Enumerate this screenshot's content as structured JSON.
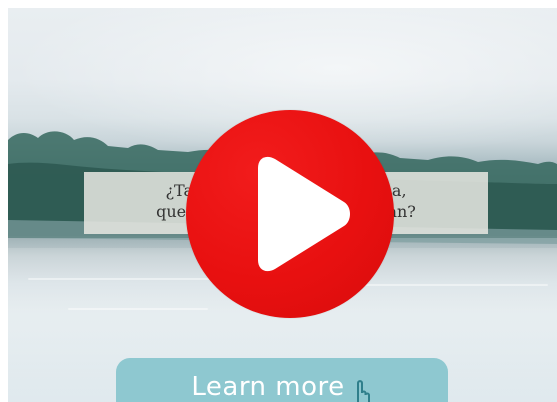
{
  "video": {
    "subtitle": {
      "line1": "¿Tan p",
      "line1_right": "ersona,",
      "line2": "que has",
      "line2_right": "a pisan?"
    },
    "play_icon": "play-icon"
  },
  "cta": {
    "label": "Learn more",
    "icon": "pointing-hand-icon"
  },
  "colors": {
    "play_button": "#e81010",
    "cta_background": "#8ec8d0",
    "cta_text": "#ffffff"
  }
}
